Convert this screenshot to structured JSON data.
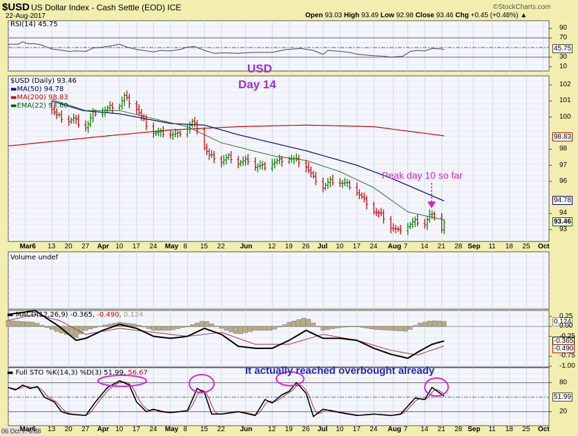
{
  "header": {
    "symbol": "$USD",
    "name": "US Dollar Index - Cash Settle (EOD) ICE",
    "date": "22-Aug-2017",
    "brand": "©StockCharts.com",
    "open_label": "Open",
    "open": "93.03",
    "high_label": "High",
    "high": "93.49",
    "low_label": "Low",
    "low": "92.98",
    "close_label": "Close",
    "close": "93.46",
    "chg_label": "Chg",
    "chg": "+0.45 (+0.48%)"
  },
  "annotations": {
    "usd": "USD",
    "day": "Day 14",
    "peak": "Peak day 10 so far",
    "overbought": "It actually reached overbought already"
  },
  "footer": {
    "cursor": "06 Oct Y:-6.88"
  },
  "colors": {
    "up": "#008000",
    "down": "#cc0000",
    "ma50": "#000080",
    "ma200": "#cc0000",
    "ema22": "#006000",
    "purple": "#9b2fd6",
    "magenta": "#e020c8",
    "blue": "#2525d0"
  },
  "chart_data": [
    {
      "type": "line",
      "title": "RSI(14) 45.75",
      "legend": "RSI(14) 45.75",
      "ylim": [
        1,
        106
      ],
      "yticks": [
        "90",
        "70",
        "30",
        "10"
      ],
      "ytick_values": [
        90,
        70,
        30,
        10
      ],
      "last": "45.75",
      "series": [
        {
          "name": "RSI",
          "points": [
            [
              -11,
              57
            ],
            [
              -7,
              57
            ],
            [
              -5,
              62
            ],
            [
              -3,
              58
            ],
            [
              0,
              58
            ],
            [
              3,
              55
            ],
            [
              7,
              47
            ],
            [
              10,
              45
            ],
            [
              14,
              42
            ],
            [
              17,
              43
            ],
            [
              21,
              42
            ],
            [
              24,
              49
            ],
            [
              28,
              51
            ],
            [
              31,
              53
            ],
            [
              35,
              57
            ],
            [
              38,
              51
            ],
            [
              42,
              46
            ],
            [
              46,
              43
            ],
            [
              49,
              41
            ],
            [
              52,
              44
            ],
            [
              56,
              43
            ],
            [
              60,
              46
            ],
            [
              63,
              51
            ],
            [
              66,
              52
            ],
            [
              70,
              44
            ],
            [
              74,
              38
            ],
            [
              78,
              39
            ],
            [
              84,
              38
            ],
            [
              90,
              40
            ],
            [
              98,
              40
            ],
            [
              104,
              46
            ],
            [
              110,
              48
            ],
            [
              115,
              44
            ],
            [
              119,
              36
            ],
            [
              121,
              44
            ],
            [
              126,
              42
            ],
            [
              130,
              40
            ],
            [
              133,
              36
            ],
            [
              140,
              33
            ],
            [
              144,
              32
            ],
            [
              147,
              30
            ],
            [
              152,
              32
            ],
            [
              155,
              42
            ],
            [
              158,
              44
            ],
            [
              161,
              43
            ],
            [
              164,
              48
            ],
            [
              168,
              47
            ],
            [
              169,
              45.75
            ]
          ]
        }
      ]
    },
    {
      "type": "ohlc",
      "title": "$USD (Daily) 93.46",
      "legend": "$USD (Daily) 93.46",
      "ylim": [
        92.26,
        102.56
      ],
      "yticks": [
        "102",
        "101",
        "100",
        "98",
        "97",
        "96",
        "94",
        "93"
      ],
      "ytick_values": [
        102,
        101,
        100,
        98,
        97,
        96,
        94,
        93
      ],
      "legend_ma50": "MA(50) 94.78",
      "legend_ma200": "MA(200) 98.83",
      "legend_ema": "EMA(22) 93.60",
      "flag_ma200": "98.83",
      "flag_ma50": "94.78",
      "flag_close": "93.46",
      "close_points": [
        [
          7,
          100.6
        ],
        [
          9,
          100.1
        ],
        [
          13,
          99.8
        ],
        [
          16,
          99.9
        ],
        [
          20,
          99.3
        ],
        [
          22,
          99.6
        ],
        [
          24,
          100.2
        ],
        [
          28,
          100.4
        ],
        [
          31,
          100.6
        ],
        [
          35,
          100.8
        ],
        [
          37,
          101.3
        ],
        [
          39,
          100.9
        ],
        [
          42,
          100.6
        ],
        [
          44,
          100.0
        ],
        [
          46,
          99.5
        ],
        [
          49,
          99.1
        ],
        [
          52,
          99.0
        ],
        [
          56,
          99.0
        ],
        [
          59,
          98.9
        ],
        [
          62,
          99.2
        ],
        [
          65,
          99.7
        ],
        [
          67,
          99.3
        ],
        [
          70,
          98.2
        ],
        [
          72,
          97.6
        ],
        [
          77,
          97.3
        ],
        [
          80,
          97.5
        ],
        [
          84,
          97.2
        ],
        [
          88,
          97.3
        ],
        [
          91,
          97.0
        ],
        [
          95,
          96.9
        ],
        [
          98,
          97.2
        ],
        [
          102,
          97.3
        ],
        [
          105,
          97.5
        ],
        [
          108,
          97.3
        ],
        [
          112,
          97.0
        ],
        [
          115,
          96.2
        ],
        [
          119,
          95.7
        ],
        [
          122,
          96.0
        ],
        [
          126,
          96.0
        ],
        [
          129,
          95.8
        ],
        [
          133,
          95.4
        ],
        [
          136,
          94.8
        ],
        [
          140,
          94.2
        ],
        [
          143,
          93.9
        ],
        [
          147,
          93.2
        ],
        [
          150,
          92.9
        ],
        [
          154,
          93.3
        ],
        [
          157,
          93.5
        ],
        [
          161,
          93.4
        ],
        [
          163,
          93.9
        ],
        [
          165,
          93.8
        ],
        [
          168,
          93.1
        ],
        [
          169,
          93.46
        ]
      ],
      "series": [
        {
          "name": "MA(50)",
          "points": [
            [
              7,
              101.0
            ],
            [
              20,
              100.4
            ],
            [
              35,
              100.2
            ],
            [
              56,
              99.6
            ],
            [
              70,
              99.5
            ],
            [
              84,
              98.9
            ],
            [
              98,
              98.4
            ],
            [
              112,
              97.9
            ],
            [
              133,
              97.0
            ],
            [
              147,
              96.2
            ],
            [
              169,
              94.78
            ]
          ]
        },
        {
          "name": "MA(200)",
          "points": [
            [
              -11,
              98.2
            ],
            [
              28,
              98.8
            ],
            [
              56,
              99.2
            ],
            [
              84,
              99.4
            ],
            [
              112,
              99.5
            ],
            [
              140,
              99.4
            ],
            [
              169,
              98.83
            ]
          ]
        },
        {
          "name": "EMA(22)",
          "points": [
            [
              7,
              101.1
            ],
            [
              21,
              100.4
            ],
            [
              35,
              100.4
            ],
            [
              49,
              99.9
            ],
            [
              63,
              99.4
            ],
            [
              77,
              98.4
            ],
            [
              98,
              97.6
            ],
            [
              112,
              97.3
            ],
            [
              126,
              96.6
            ],
            [
              140,
              95.6
            ],
            [
              154,
              94.1
            ],
            [
              169,
              93.6
            ]
          ]
        }
      ]
    },
    {
      "type": "bar",
      "title": "Volume undef",
      "legend": "Volume undef"
    },
    {
      "type": "line",
      "title": "MACD(12,26,9)",
      "legend_a": "MACD(12,26,9) -0.365,",
      "legend_b": "-0.490,",
      "legend_c": "0.124",
      "ylim": [
        -1.02,
        0.4
      ],
      "yticks": [
        "0.25",
        "0.00",
        "-0.25",
        "-0.75",
        "-1.00"
      ],
      "ytick_values": [
        0.25,
        0,
        -0.25,
        -0.75,
        -1.0
      ],
      "flag_hist": "0.124",
      "flag_macd": "-0.365",
      "flag_signal": "-0.490",
      "series": [
        {
          "name": "MACD",
          "points": [
            [
              -11,
              0.3
            ],
            [
              -5,
              0.35
            ],
            [
              0,
              0.4
            ],
            [
              10,
              0.0
            ],
            [
              17,
              -0.35
            ],
            [
              21,
              -0.3
            ],
            [
              28,
              -0.1
            ],
            [
              35,
              0.05
            ],
            [
              42,
              -0.05
            ],
            [
              49,
              -0.25
            ],
            [
              56,
              -0.3
            ],
            [
              63,
              -0.25
            ],
            [
              70,
              -0.05
            ],
            [
              77,
              -0.2
            ],
            [
              84,
              -0.5
            ],
            [
              91,
              -0.55
            ],
            [
              98,
              -0.55
            ],
            [
              105,
              -0.35
            ],
            [
              112,
              -0.1
            ],
            [
              119,
              -0.3
            ],
            [
              126,
              -0.3
            ],
            [
              133,
              -0.35
            ],
            [
              140,
              -0.55
            ],
            [
              147,
              -0.7
            ],
            [
              154,
              -0.8
            ],
            [
              158,
              -0.65
            ],
            [
              164,
              -0.45
            ],
            [
              169,
              -0.365
            ]
          ]
        },
        {
          "name": "Signal",
          "points": [
            [
              -11,
              0.15
            ],
            [
              0,
              0.3
            ],
            [
              10,
              0.15
            ],
            [
              21,
              -0.2
            ],
            [
              35,
              -0.05
            ],
            [
              49,
              -0.15
            ],
            [
              63,
              -0.25
            ],
            [
              77,
              -0.15
            ],
            [
              91,
              -0.45
            ],
            [
              105,
              -0.45
            ],
            [
              119,
              -0.2
            ],
            [
              133,
              -0.35
            ],
            [
              147,
              -0.6
            ],
            [
              158,
              -0.72
            ],
            [
              169,
              -0.49
            ]
          ]
        }
      ]
    },
    {
      "type": "line",
      "title": "Full STO %K(14,3) %D(3)",
      "legend_a": "Full STO %K(14,3) %D(3) 51.99,",
      "legend_b": "56.67",
      "ylim": [
        -9,
        111
      ],
      "yticks": [
        "80",
        "20"
      ],
      "ytick_values": [
        80,
        20
      ],
      "flag": "51.99",
      "series": [
        {
          "name": "%K",
          "points": [
            [
              -11,
              70
            ],
            [
              -8,
              65
            ],
            [
              -5,
              75
            ],
            [
              -2,
              68
            ],
            [
              1,
              72
            ],
            [
              4,
              50
            ],
            [
              8,
              40
            ],
            [
              11,
              20
            ],
            [
              14,
              15
            ],
            [
              21,
              12
            ],
            [
              25,
              40
            ],
            [
              30,
              70
            ],
            [
              35,
              84
            ],
            [
              39,
              75
            ],
            [
              42,
              40
            ],
            [
              46,
              20
            ],
            [
              49,
              25
            ],
            [
              52,
              20
            ],
            [
              56,
              18
            ],
            [
              63,
              22
            ],
            [
              67,
              68
            ],
            [
              70,
              60
            ],
            [
              73,
              15
            ],
            [
              77,
              15
            ],
            [
              84,
              20
            ],
            [
              91,
              12
            ],
            [
              95,
              45
            ],
            [
              98,
              38
            ],
            [
              102,
              55
            ],
            [
              105,
              62
            ],
            [
              108,
              80
            ],
            [
              112,
              58
            ],
            [
              115,
              10
            ],
            [
              119,
              25
            ],
            [
              126,
              18
            ],
            [
              133,
              12
            ],
            [
              140,
              15
            ],
            [
              147,
              12
            ],
            [
              151,
              15
            ],
            [
              157,
              48
            ],
            [
              161,
              45
            ],
            [
              164,
              70
            ],
            [
              169,
              51.99
            ]
          ]
        }
      ]
    }
  ],
  "xaxis": {
    "ticks": [
      {
        "label": "Mar6",
        "day": -4,
        "bold": true
      },
      {
        "label": "13",
        "day": 7
      },
      {
        "label": "20",
        "day": 14
      },
      {
        "label": "27",
        "day": 21
      },
      {
        "label": "Apr",
        "day": 28,
        "bold": true
      },
      {
        "label": "10",
        "day": 35
      },
      {
        "label": "17",
        "day": 42
      },
      {
        "label": "24",
        "day": 49
      },
      {
        "label": "May",
        "day": 56,
        "bold": true
      },
      {
        "label": "8",
        "day": 63
      },
      {
        "label": "15",
        "day": 70
      },
      {
        "label": "22",
        "day": 77
      },
      {
        "label": "Jun",
        "day": 87,
        "bold": true
      },
      {
        "label": "12",
        "day": 98
      },
      {
        "label": "19",
        "day": 105
      },
      {
        "label": "26",
        "day": 112
      },
      {
        "label": "Jul",
        "day": 119,
        "bold": true
      },
      {
        "label": "10",
        "day": 126
      },
      {
        "label": "17",
        "day": 133
      },
      {
        "label": "24",
        "day": 140
      },
      {
        "label": "Aug",
        "day": 148,
        "bold": true
      },
      {
        "label": "7",
        "day": 154
      },
      {
        "label": "14",
        "day": 161
      },
      {
        "label": "21",
        "day": 168
      },
      {
        "label": "28",
        "day": 175
      },
      {
        "label": "Sep",
        "day": 181,
        "bold": true
      },
      {
        "label": "11",
        "day": 189
      },
      {
        "label": "18",
        "day": 196
      },
      {
        "label": "25",
        "day": 203
      },
      {
        "label": "Oct",
        "day": 210,
        "bold": true
      }
    ]
  }
}
